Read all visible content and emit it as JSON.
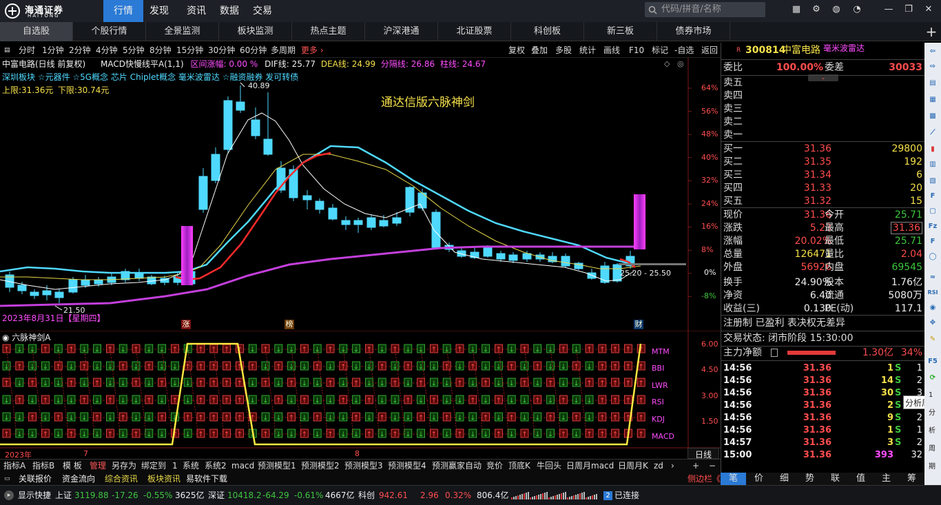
{
  "app": {
    "logo_text": "海通证券",
    "logo_sub": "HAITONG",
    "nav": [
      "行情",
      "发现",
      "资讯",
      "数据",
      "交易"
    ],
    "search_placeholder": "代码/拼音/名称"
  },
  "tabs": [
    "自选股",
    "个股行情",
    "全景监测",
    "板块监测",
    "热点主题",
    "沪深港通",
    "北证股票",
    "科创板",
    "新三板",
    "债券市场"
  ],
  "period": {
    "items": [
      "分时",
      "1分钟",
      "2分钟",
      "4分钟",
      "5分钟",
      "8分钟",
      "15分钟",
      "30分钟",
      "60分钟",
      "多周期"
    ],
    "more": "更多 ›",
    "tools": [
      "复权",
      "叠加",
      "多股",
      "统计",
      "画线",
      "F10",
      "标记",
      "-自选",
      "返回"
    ]
  },
  "chart": {
    "title": "中富电路(日线 前复权)",
    "indicator": "MACD快慢线平A(1,1)",
    "range_label": "区间涨幅: 0.00 %",
    "dif": "DIF线: 25.77",
    "dea": "DEA线: 24.99",
    "fengge": "分隔线: 26.86",
    "zhu": "柱线: 24.67",
    "concepts": "深圳板块 ☆元器件 ☆5G概念 芯片 Chiplet概念 毫米波雷达 ☆融资融券 发可转债",
    "upper": "上限:31.36元",
    "lower": "下限:30.74元",
    "label_main": "通达信版六脉神剑",
    "high_label": "40.89",
    "low_label": "21.50",
    "range_box": "25.20 - 25.50",
    "date_label": "2023年8月31日【星期四】",
    "markers": [
      "涨",
      "榜",
      "财"
    ],
    "pct_ticks": [
      "64%",
      "56%",
      "48%",
      "40%",
      "32%",
      "24%",
      "16%",
      "8%",
      "0%",
      "-8%"
    ]
  },
  "ind": {
    "title": "六脉神剑A",
    "lines": [
      "MTM",
      "BBI",
      "LWR",
      "RSI",
      "KDJ",
      "MACD"
    ],
    "ticks": [
      "6.00",
      "4.50",
      "3.00",
      "1.50"
    ],
    "x_labels": [
      "2023年",
      "7",
      "8"
    ],
    "axis_btn": "日线"
  },
  "bottomtabs": [
    "指标A",
    "指标B",
    "模 板",
    "管理",
    "另存为",
    "绑定到",
    "1",
    "系统",
    "系统2",
    "macd",
    "预测模型1",
    "预测模型2",
    "预测模型3",
    "预测模型4",
    "预测赢家自动",
    "竞价",
    "顶底K",
    "牛回头",
    "日周月macd",
    "日周月K",
    "zd"
  ],
  "links": [
    "关联报价",
    "资金流向",
    "综合资讯",
    "板块资讯",
    "易软件下载"
  ],
  "sidebar_toggle": "侧边栏《",
  "stock": {
    "code": "300814",
    "name": "中富电路",
    "tag": "毫米波雷达",
    "weibi": "100.00%",
    "weicha": "30033",
    "sell": [
      {
        "l": "卖五",
        "p": "",
        "v": ""
      },
      {
        "l": "卖四",
        "p": "",
        "v": ""
      },
      {
        "l": "卖三",
        "p": "",
        "v": ""
      },
      {
        "l": "卖二",
        "p": "",
        "v": ""
      },
      {
        "l": "卖一",
        "p": "",
        "v": ""
      }
    ],
    "buy": [
      {
        "l": "买一",
        "p": "31.36",
        "v": "29800"
      },
      {
        "l": "买二",
        "p": "31.35",
        "v": "192"
      },
      {
        "l": "买三",
        "p": "31.34",
        "v": "6"
      },
      {
        "l": "买四",
        "p": "31.33",
        "v": "20"
      },
      {
        "l": "买五",
        "p": "31.32",
        "v": "15"
      }
    ],
    "quote": [
      {
        "a": "现价",
        "av": "31.36",
        "b": "今开",
        "bv": "25.71"
      },
      {
        "a": "涨跌",
        "av": "5.23",
        "b": "最高",
        "bv": "31.36"
      },
      {
        "a": "涨幅",
        "av": "20.02%",
        "b": "最低",
        "bv": "25.71"
      },
      {
        "a": "总量",
        "av": "126471",
        "b": "量比",
        "bv": "2.04"
      },
      {
        "a": "外盘",
        "av": "56926",
        "b": "内盘",
        "bv": "69545"
      },
      {
        "a": "换手",
        "av": "24.90%",
        "b": "股本",
        "bv": "1.76亿"
      },
      {
        "a": "净资",
        "av": "6.40",
        "b": "流通",
        "bv": "5080万"
      },
      {
        "a": "收益(三)",
        "av": "0.130",
        "b": "PE(动)",
        "bv": "117.1"
      }
    ],
    "note": "注册制 已盈利 表决权无差异",
    "trade_state": "交易状态: 闭市阶段 15:30:00",
    "main_flow_label": "主力净额",
    "main_flow": "1.30亿",
    "main_flow_pct": "34%",
    "ticks": [
      {
        "t": "14:56",
        "p": "31.36",
        "v": "1",
        "s": "S",
        "n": "1"
      },
      {
        "t": "14:56",
        "p": "31.36",
        "v": "14",
        "s": "S",
        "n": "2"
      },
      {
        "t": "14:56",
        "p": "31.36",
        "v": "30",
        "s": "S",
        "n": "3"
      },
      {
        "t": "14:56",
        "p": "31.36",
        "v": "2",
        "s": "S",
        "n": "2"
      },
      {
        "t": "14:56",
        "p": "31.36",
        "v": "9",
        "s": "S",
        "n": "2"
      },
      {
        "t": "14:56",
        "p": "31.36",
        "v": "1",
        "s": "S",
        "n": "1"
      },
      {
        "t": "14:57",
        "p": "31.36",
        "v": "3",
        "s": "S",
        "n": "2"
      },
      {
        "t": "15:00",
        "p": "31.36",
        "v": "393",
        "s": "",
        "n": "32"
      }
    ],
    "tooltip": "分析周期"
  },
  "rtabs": [
    "笔",
    "价",
    "细",
    "势",
    "联",
    "值",
    "主",
    "筹"
  ],
  "status": {
    "label": "显示快捷",
    "sh": "上证",
    "sh_v": "3119.88",
    "sh_c": "-17.26",
    "sh_p": "-0.55%",
    "sh_a": "3625亿",
    "sz": "深证",
    "sz_v": "10418.2",
    "sz_c": "-64.29",
    "sz_p": "-0.61%",
    "sz_a": "4667亿",
    "kc": "科创",
    "kc_v": "942.61",
    "kc_c": "2.96",
    "kc_p": "0.32%",
    "kc_a": "806.4亿",
    "conn_n": "2",
    "conn": "已连接"
  },
  "colors": {
    "up": "#ff4d4d",
    "down": "#3ec63e",
    "ma_cyan": "#4fd9ff",
    "ma_yellow": "#e8d84a",
    "ma_white": "#ffffff",
    "ma_red": "#ff2a2a",
    "ma_magenta": "#c43fdc"
  }
}
